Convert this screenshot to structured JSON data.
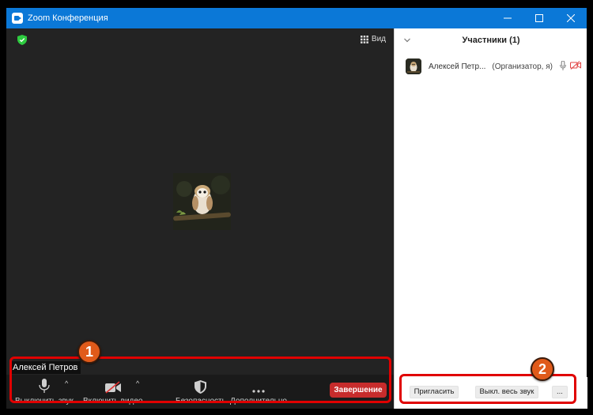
{
  "window": {
    "title": "Zoom Конференция"
  },
  "video": {
    "view_label": "Вид",
    "name_label": "Алексей Петров"
  },
  "toolbar": {
    "mute_label": "Выключить звук",
    "video_label": "Включить видео",
    "security_label": "Безопасность",
    "more_label": "Дополнительно",
    "end_label": "Завершение"
  },
  "participants": {
    "header": "Участники (1)",
    "list": [
      {
        "name": "Алексей Петр...",
        "role": "(Организатор, я)"
      }
    ],
    "invite_label": "Пригласить",
    "mute_all_label": "Выкл. весь звук",
    "more_label": "..."
  },
  "annotations": {
    "badge_1": "1",
    "badge_2": "2"
  },
  "colors": {
    "titlebar": "#0b78d7",
    "end_button": "#c72c2c",
    "highlight": "#e00000",
    "badge": "#e05a1a",
    "shield": "#2ecc40"
  }
}
